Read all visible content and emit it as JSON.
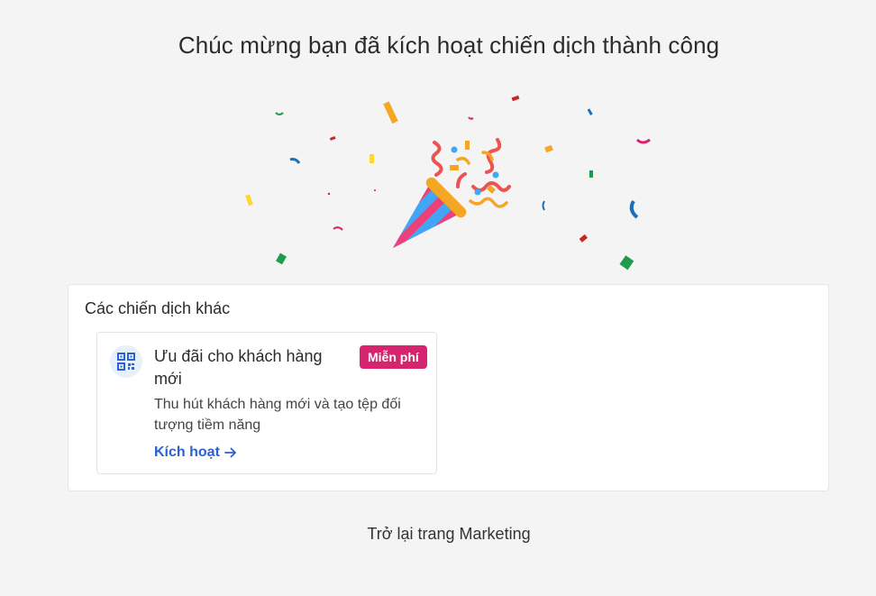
{
  "header": {
    "title": "Chúc mừng bạn đã kích hoạt chiến dịch thành công"
  },
  "celebration": {
    "icon": "party-popper-icon"
  },
  "other_campaigns": {
    "title": "Các chiến dịch khác",
    "items": [
      {
        "icon": "qr-code-icon",
        "name": "Ưu đãi cho khách hàng mới",
        "badge": "Miễn phí",
        "description": "Thu hút khách hàng mới và tạo tệp đối tượng tiềm năng",
        "action_label": "Kích hoạt",
        "action_icon": "arrow-right-icon"
      }
    ]
  },
  "footer": {
    "back_label": "Trở lại trang Marketing"
  },
  "colors": {
    "badge": "#d6256f",
    "link": "#2a62d6",
    "background": "#f4f4f4"
  }
}
